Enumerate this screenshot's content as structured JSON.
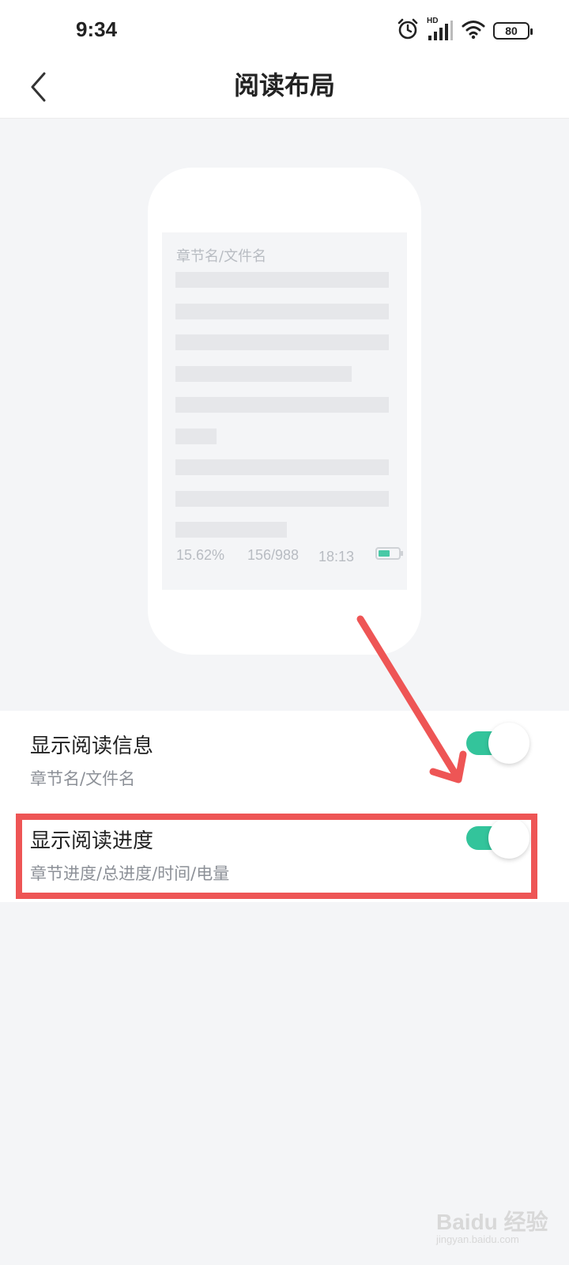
{
  "status_bar": {
    "time": "9:34",
    "network_badge": "HD",
    "battery_level": "80",
    "icons": [
      "alarm-icon",
      "signal-icon",
      "wifi-icon",
      "battery-icon"
    ]
  },
  "header": {
    "title": "阅读布局",
    "back_icon": "chevron-left-icon"
  },
  "preview": {
    "chapter_label": "章节名/文件名",
    "chapter_progress": "15.62%",
    "page_progress": "156/988",
    "clock": "18:13"
  },
  "settings": [
    {
      "title": "显示阅读信息",
      "description": "章节名/文件名",
      "enabled": true
    },
    {
      "title": "显示阅读进度",
      "description": "章节进度/总进度/时间/电量",
      "enabled": true
    }
  ],
  "watermark": {
    "brand": "Baidu 经验",
    "url": "jingyan.baidu.com"
  },
  "colors": {
    "accent": "#33c49b",
    "annotation": "#ee5555",
    "background": "#f4f5f7"
  }
}
